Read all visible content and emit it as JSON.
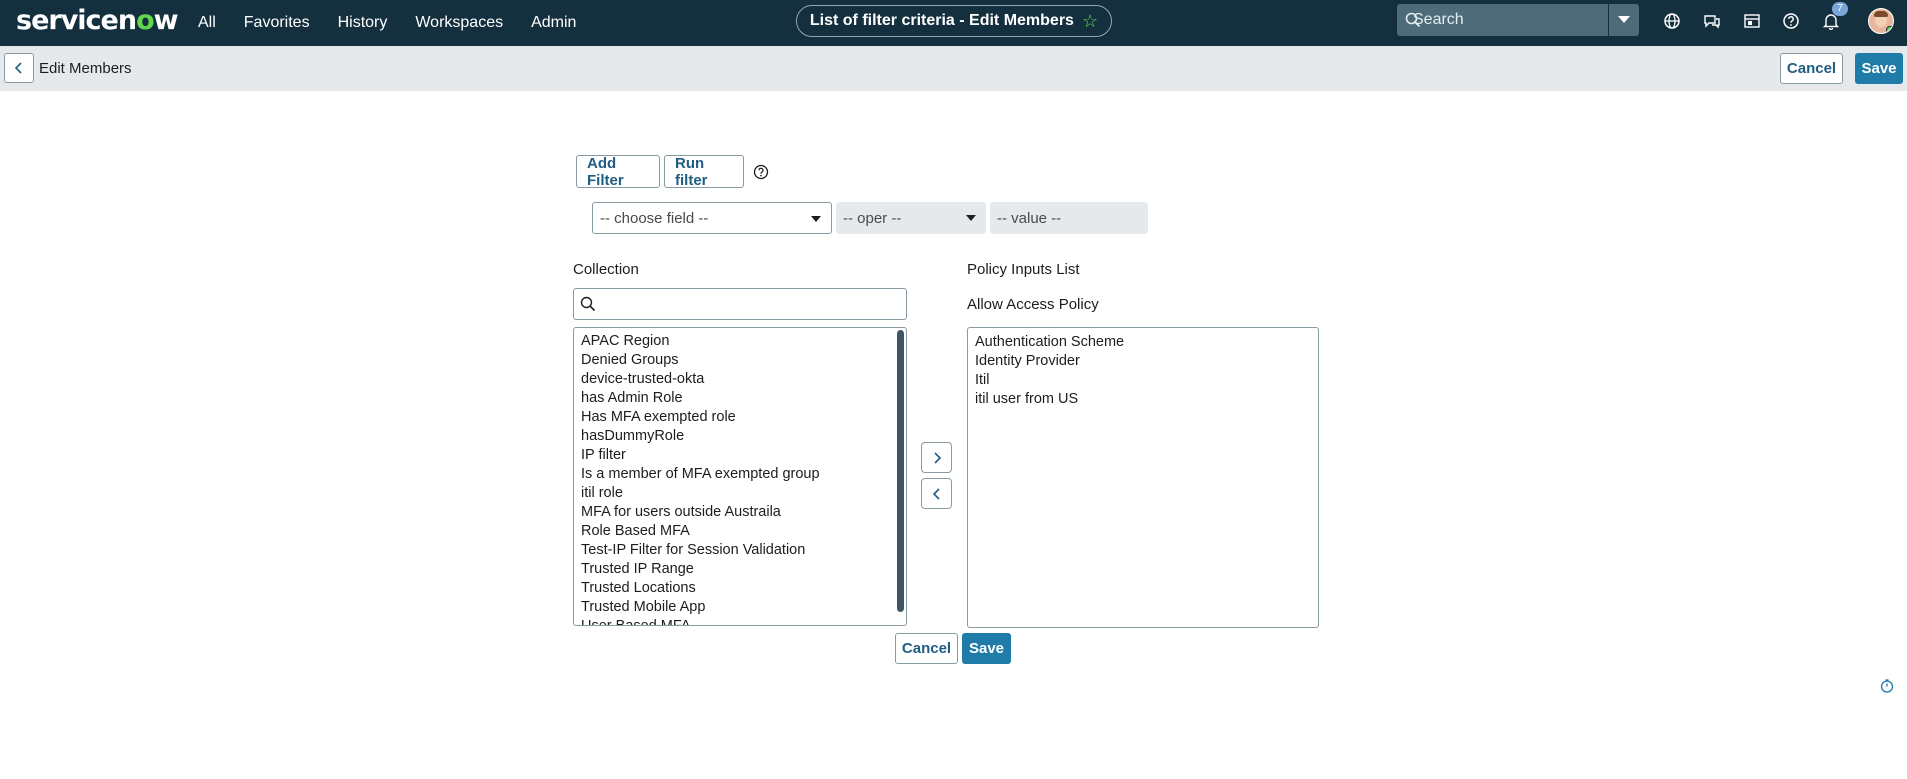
{
  "app": {
    "logo_text": "servicenow",
    "nav": [
      "All",
      "Favorites",
      "History",
      "Workspaces",
      "Admin"
    ],
    "title": "List of filter criteria - Edit Members",
    "search_placeholder": "Search",
    "notification_count": "7"
  },
  "subheader": {
    "title": "Edit Members",
    "cancel_label": "Cancel",
    "save_label": "Save"
  },
  "filter": {
    "add_filter_label": "Add Filter",
    "run_filter_label": "Run filter",
    "field_placeholder": "-- choose field --",
    "oper_placeholder": "-- oper --",
    "value_placeholder": "-- value --"
  },
  "collection": {
    "heading": "Collection",
    "search_value": "",
    "items": [
      "APAC Region",
      "Denied Groups",
      "device-trusted-okta",
      "has Admin Role",
      "Has MFA exempted role",
      "hasDummyRole",
      "IP filter",
      "Is a member of MFA exempted group",
      "itil role",
      "MFA for users outside Austraila",
      "Role Based MFA",
      "Test-IP Filter for Session Validation",
      "Trusted IP Range",
      "Trusted Locations",
      "Trusted Mobile App",
      "User Based MFA"
    ]
  },
  "policy": {
    "heading": "Policy Inputs List",
    "subheading": "Allow Access Policy",
    "items": [
      "Authentication Scheme",
      "Identity Provider",
      "Itil",
      "itil user from US"
    ]
  },
  "footer": {
    "cancel_label": "Cancel",
    "save_label": "Save"
  },
  "colors": {
    "nav_bg": "#14303f",
    "accent_green": "#62d84e",
    "primary_button": "#1f7ba8",
    "subheader_bg": "#e6e9eb"
  }
}
